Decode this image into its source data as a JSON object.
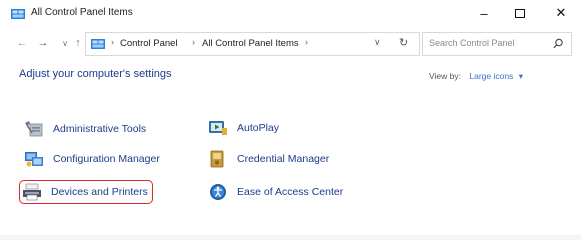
{
  "window": {
    "title": "All Control Panel Items",
    "minimize_glyph": "–",
    "close_glyph": "✕"
  },
  "navigation": {
    "back_glyph": "←",
    "forward_glyph": "→",
    "recent_glyph": "∨",
    "up_glyph": "↑",
    "breadcrumbs": [
      "Control Panel",
      "All Control Panel Items"
    ],
    "separator": "›",
    "dropdown_glyph": "∨",
    "refresh_glyph": "↻",
    "search_placeholder": "Search Control Panel"
  },
  "content": {
    "heading": "Adjust your computer's settings",
    "view_by_label": "View by:",
    "view_by_value": "Large icons",
    "view_by_caret": "▾",
    "items": [
      {
        "label": "Administrative Tools",
        "icon": "administrative-tools-icon",
        "selected": false
      },
      {
        "label": "AutoPlay",
        "icon": "autoplay-icon",
        "selected": false
      },
      {
        "label": "Configuration Manager",
        "icon": "configuration-manager-icon",
        "selected": false
      },
      {
        "label": "Credential Manager",
        "icon": "credential-manager-icon",
        "selected": false
      },
      {
        "label": "Devices and Printers",
        "icon": "printer-icon",
        "selected": true
      },
      {
        "label": "Ease of Access Center",
        "icon": "ease-of-access-icon",
        "selected": false
      }
    ]
  },
  "colors": {
    "link_blue": "#1f3b8c",
    "accent_blue": "#3b6fd0",
    "highlight_red": "#e0242b"
  }
}
